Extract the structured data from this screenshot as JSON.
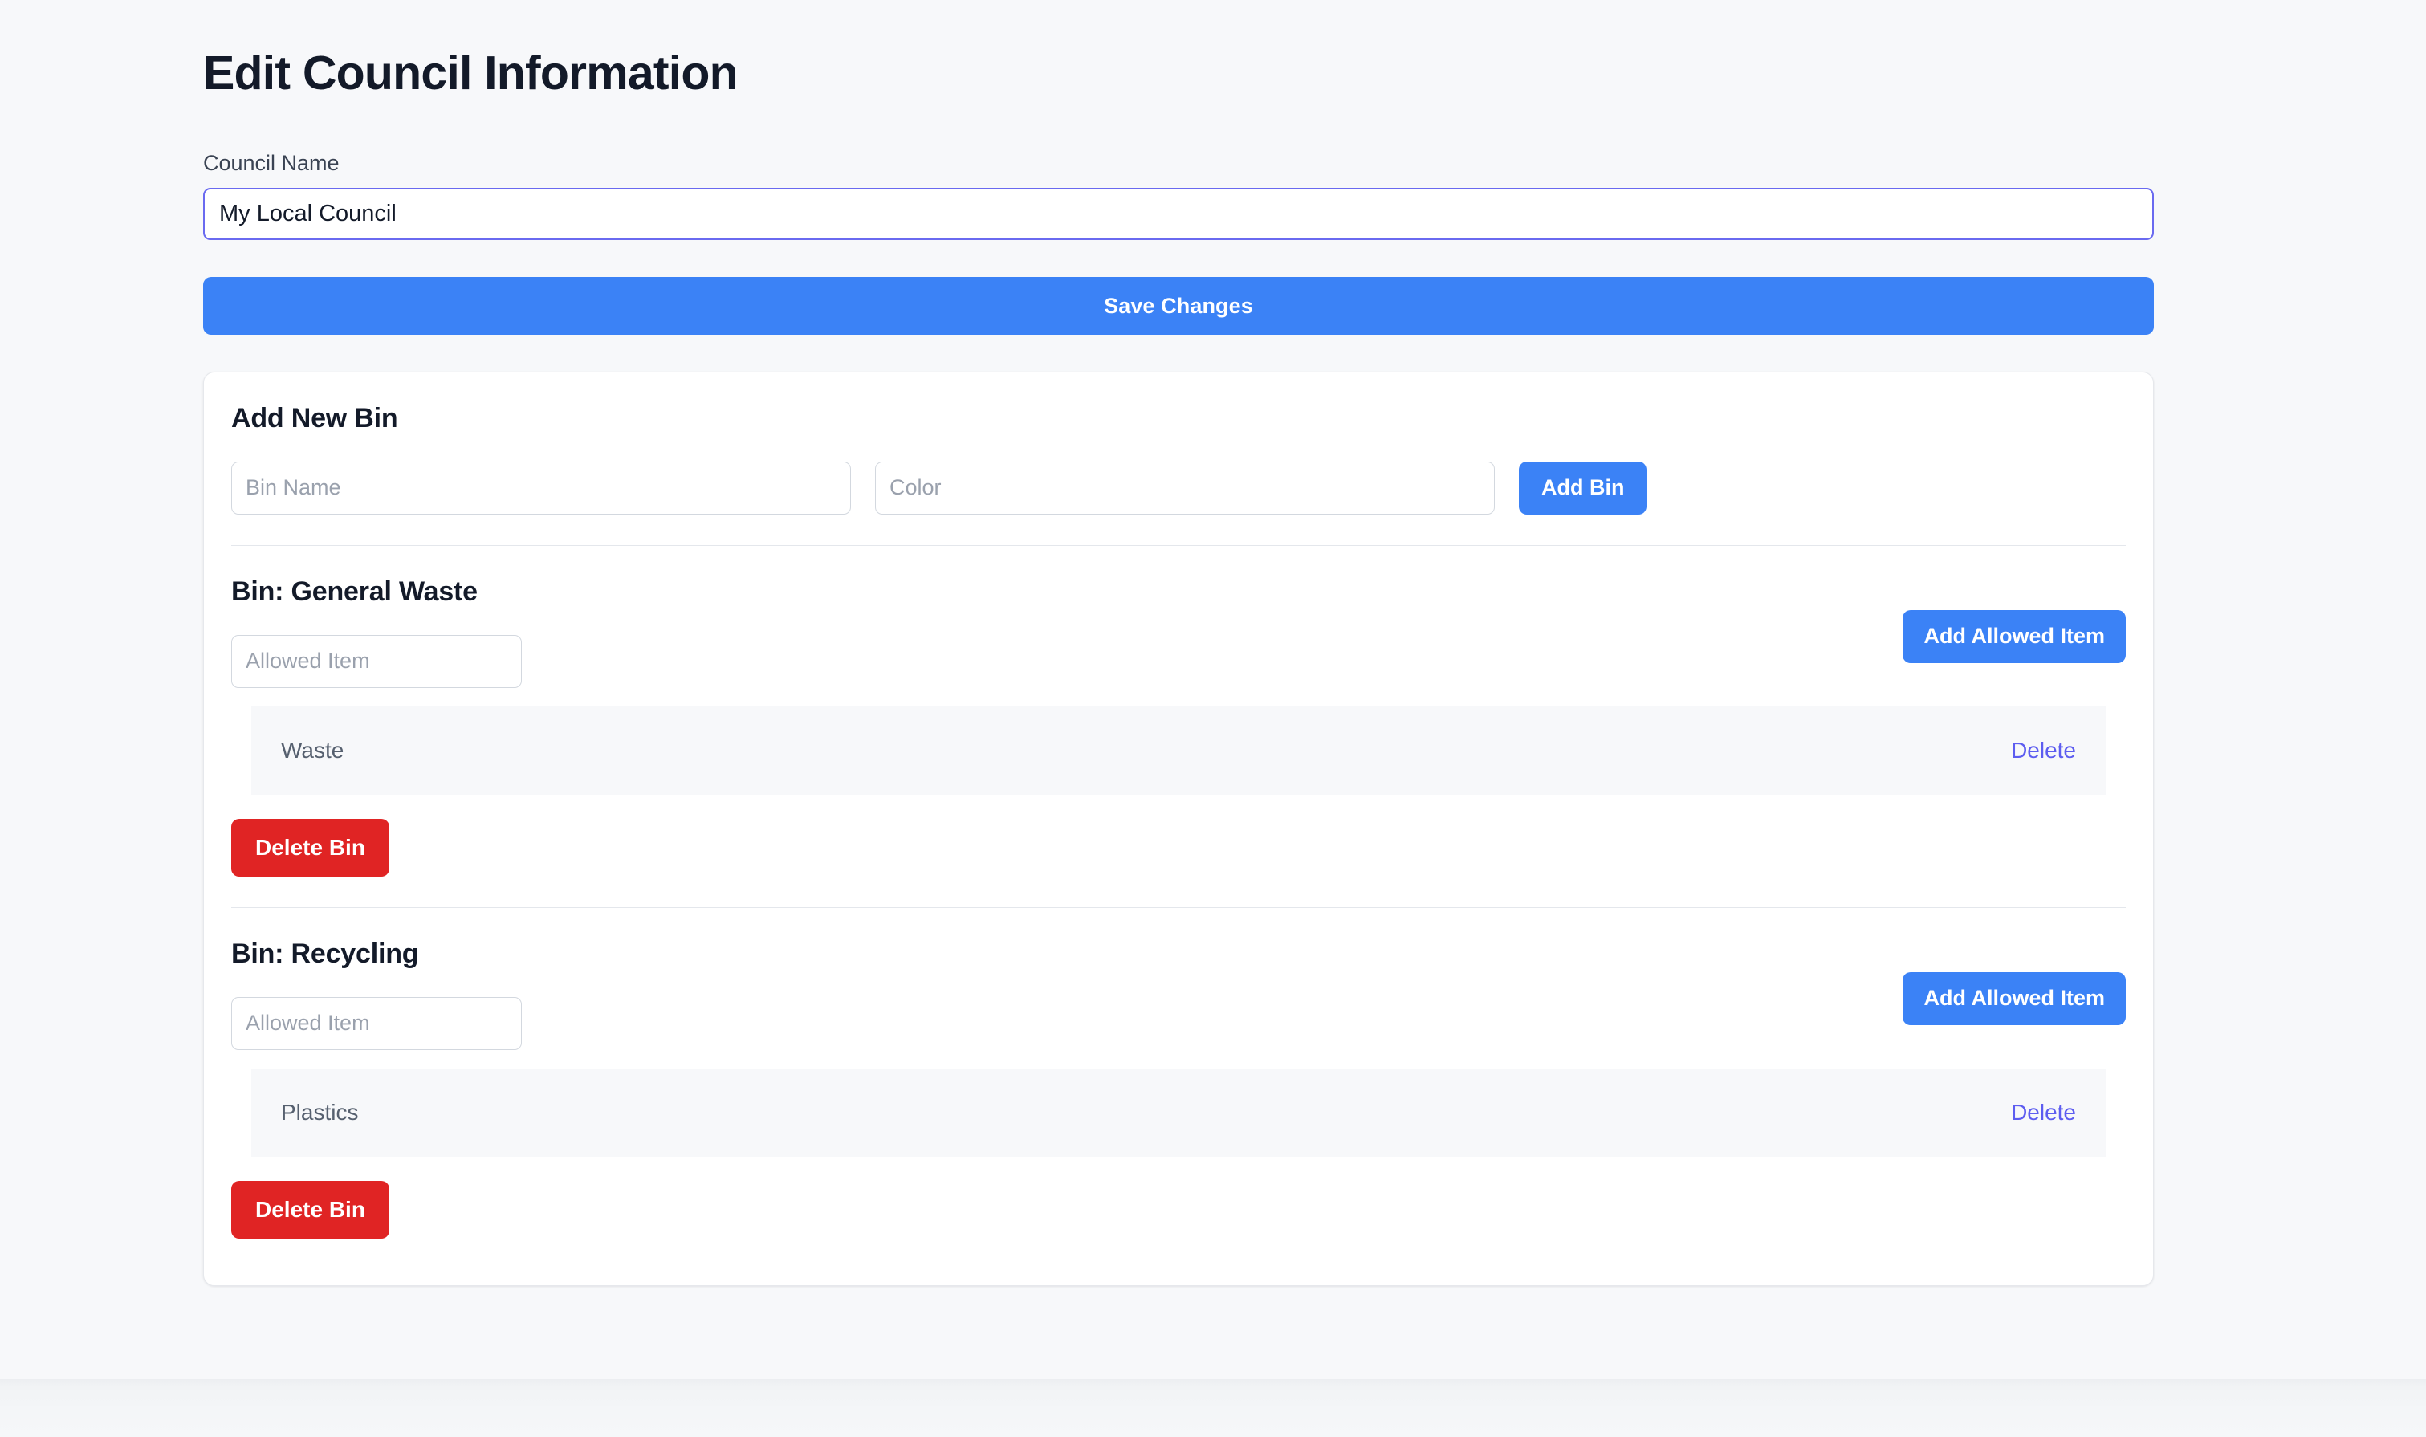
{
  "page": {
    "title": "Edit Council Information",
    "background_color": "#f7f8fa"
  },
  "council_field": {
    "label": "Council Name",
    "value": "My Local Council",
    "placeholder": "Council Name",
    "focused": true,
    "focus_border_color": "#6a6af0"
  },
  "save_button": {
    "label": "Save Changes",
    "color": "#3b82f6"
  },
  "card": {
    "add_new_bin": {
      "title": "Add New Bin",
      "bin_name_placeholder": "Bin Name",
      "bin_name_value": "",
      "color_placeholder": "Color",
      "color_value": "",
      "add_button_label": "Add Bin"
    },
    "bins": [
      {
        "heading": "Bin: General Waste",
        "allowed_item_placeholder": "Allowed Item",
        "allowed_item_value": "",
        "add_allowed_item_label": "Add Allowed Item",
        "items": [
          {
            "name": "Waste",
            "delete_label": "Delete"
          }
        ],
        "delete_bin_label": "Delete Bin"
      },
      {
        "heading": "Bin: Recycling",
        "allowed_item_placeholder": "Allowed Item",
        "allowed_item_value": "",
        "add_allowed_item_label": "Add Allowed Item",
        "items": [
          {
            "name": "Plastics",
            "delete_label": "Delete"
          }
        ],
        "delete_bin_label": "Delete Bin"
      }
    ]
  },
  "colors": {
    "primary_blue": "#3b82f6",
    "danger_red": "#e02424",
    "link_indigo": "#5d5df0",
    "heading_navy": "#131a29",
    "row_background": "#f7f8fa"
  }
}
